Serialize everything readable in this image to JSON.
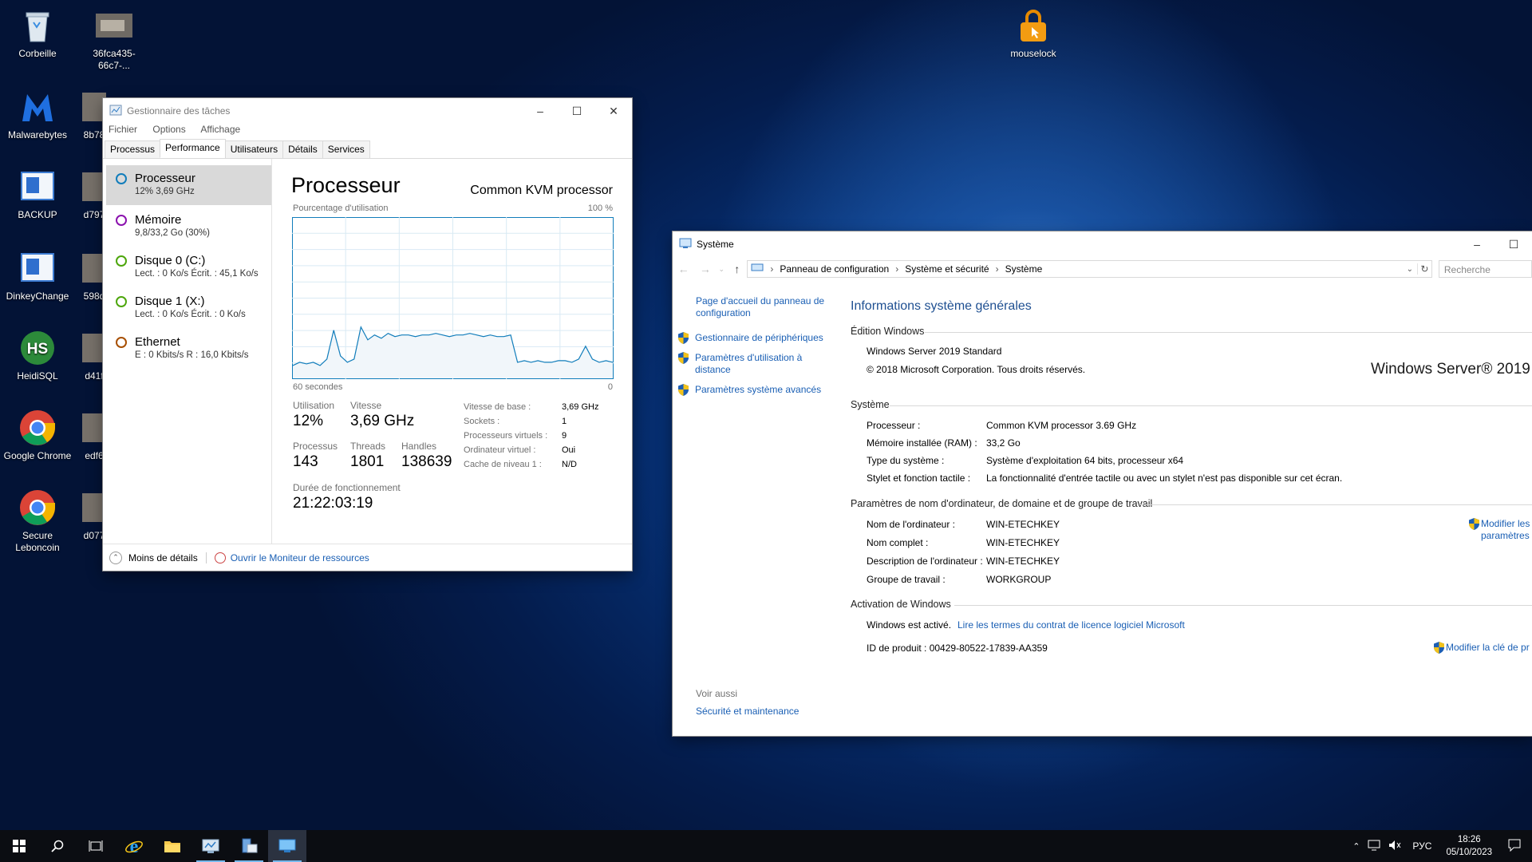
{
  "desktop": {
    "icons": [
      {
        "label": "Corbeille",
        "icon": "recycle-bin-icon"
      },
      {
        "label": "36fca435-66c7-...",
        "icon": "image-file-icon"
      },
      {
        "label": "Malwarebytes",
        "icon": "malwarebytes-icon"
      },
      {
        "label": "8b78",
        "icon": "image-file-icon"
      },
      {
        "label": "BACKUP",
        "icon": "app-shortcut-icon"
      },
      {
        "label": "d797",
        "icon": "image-file-icon"
      },
      {
        "label": "DinkeyChange",
        "icon": "app-shortcut-icon"
      },
      {
        "label": "598d",
        "icon": "image-file-icon"
      },
      {
        "label": "HeidiSQL",
        "icon": "heidisql-icon"
      },
      {
        "label": "d41f",
        "icon": "image-file-icon"
      },
      {
        "label": "Google Chrome",
        "icon": "chrome-icon"
      },
      {
        "label": "edf6",
        "icon": "image-file-icon"
      },
      {
        "label": "Secure Leboncoin",
        "icon": "chrome-icon"
      },
      {
        "label": "d077",
        "icon": "image-file-icon"
      },
      {
        "label": "mouselock",
        "icon": "lock-icon"
      }
    ]
  },
  "taskmgr": {
    "title": "Gestionnaire des tâches",
    "menu": [
      "Fichier",
      "Options",
      "Affichage"
    ],
    "tabs": [
      "Processus",
      "Performance",
      "Utilisateurs",
      "Détails",
      "Services"
    ],
    "active_tab": "Performance",
    "resources": [
      {
        "name": "Processeur",
        "detail": "12% 3,69 GHz",
        "color": "#117dbb"
      },
      {
        "name": "Mémoire",
        "detail": "9,8/33,2 Go (30%)",
        "color": "#8b12ae"
      },
      {
        "name": "Disque 0 (C:)",
        "detail": "Lect. : 0 Ko/s Écrit. : 45,1 Ko/s",
        "color": "#4da60c"
      },
      {
        "name": "Disque 1 (X:)",
        "detail": "Lect. : 0 Ko/s Écrit. : 0 Ko/s",
        "color": "#4da60c"
      },
      {
        "name": "Ethernet",
        "detail": "E : 0 Kbits/s R : 16,0 Kbits/s",
        "color": "#a74f01"
      }
    ],
    "panel": {
      "title": "Processeur",
      "model": "Common KVM processor",
      "graph_label": "Pourcentage d'utilisation",
      "graph_max": "100 %",
      "graph_time": "60 secondes",
      "graph_min": "0",
      "stats": {
        "utilisation_label": "Utilisation",
        "utilisation": "12%",
        "vitesse_label": "Vitesse",
        "vitesse": "3,69 GHz",
        "processus_label": "Processus",
        "processus": "143",
        "threads_label": "Threads",
        "threads": "1801",
        "handles_label": "Handles",
        "handles": "138639",
        "uptime_label": "Durée de fonctionnement",
        "uptime": "21:22:03:19"
      },
      "details": [
        {
          "k": "Vitesse de base :",
          "v": "3,69 GHz"
        },
        {
          "k": "Sockets :",
          "v": "1"
        },
        {
          "k": "Processeurs virtuels :",
          "v": "9"
        },
        {
          "k": "Ordinateur virtuel :",
          "v": "Oui"
        },
        {
          "k": "Cache de niveau 1 :",
          "v": "N/D"
        }
      ]
    },
    "cpu_history_percent": [
      8,
      10,
      9,
      10,
      8,
      12,
      30,
      14,
      10,
      12,
      32,
      24,
      27,
      25,
      28,
      26,
      27,
      27,
      26,
      27,
      27,
      28,
      27,
      26,
      27,
      27,
      28,
      27,
      26,
      27,
      26,
      26,
      27,
      10,
      11,
      10,
      11,
      10,
      10,
      11,
      11,
      10,
      12,
      20,
      12,
      10,
      11,
      10
    ],
    "footer": {
      "less": "Moins de détails",
      "monitor": "Ouvrir le Moniteur de ressources"
    }
  },
  "system": {
    "title": "Système",
    "breadcrumb": [
      "Panneau de configuration",
      "Système et sécurité",
      "Système"
    ],
    "search_placeholder": "Recherche",
    "left_links": {
      "home": "Page d'accueil du panneau de configuration",
      "devices": "Gestionnaire de périphériques",
      "remote": "Paramètres d'utilisation à distance",
      "advanced": "Paramètres système avancés",
      "see_also": "Voir aussi",
      "security": "Sécurité et maintenance"
    },
    "heading": "Informations système générales",
    "edition_section": "Édition Windows",
    "edition": "Windows Server 2019 Standard",
    "copyright": "© 2018 Microsoft Corporation. Tous droits réservés.",
    "logo_text": "Windows Server® 2019",
    "system_section": "Système",
    "system_rows": [
      {
        "k": "Processeur :",
        "v": "Common KVM processor   3.69 GHz"
      },
      {
        "k": "Mémoire installée (RAM) :",
        "v": "33,2 Go"
      },
      {
        "k": "Type du système :",
        "v": "Système d'exploitation 64 bits, processeur x64"
      },
      {
        "k": "Stylet et fonction tactile :",
        "v": "La fonctionnalité d'entrée tactile ou avec un stylet n'est pas disponible sur cet écran."
      }
    ],
    "name_section": "Paramètres de nom d'ordinateur, de domaine et de groupe de travail",
    "name_rows": [
      {
        "k": "Nom de l'ordinateur :",
        "v": "WIN-ETECHKEY"
      },
      {
        "k": "Nom complet :",
        "v": "WIN-ETECHKEY"
      },
      {
        "k": "Description de l'ordinateur :",
        "v": "WIN-ETECHKEY"
      },
      {
        "k": "Groupe de travail :",
        "v": "WORKGROUP"
      }
    ],
    "modify_settings": "Modifier les paramètres",
    "activation_section": "Activation de Windows",
    "activated": "Windows est activé.",
    "license_link": "Lire les termes du contrat de licence logiciel Microsoft",
    "product_id": "ID de produit : 00429-80522-17839-AA359",
    "change_key": "Modifier la clé de pr"
  },
  "taskbar": {
    "lang": "РУС",
    "time": "18:26",
    "date": "05/10/2023"
  },
  "colors": {
    "accent": "#0078d7",
    "link": "#1a5fb4",
    "cpu": "#117dbb"
  }
}
